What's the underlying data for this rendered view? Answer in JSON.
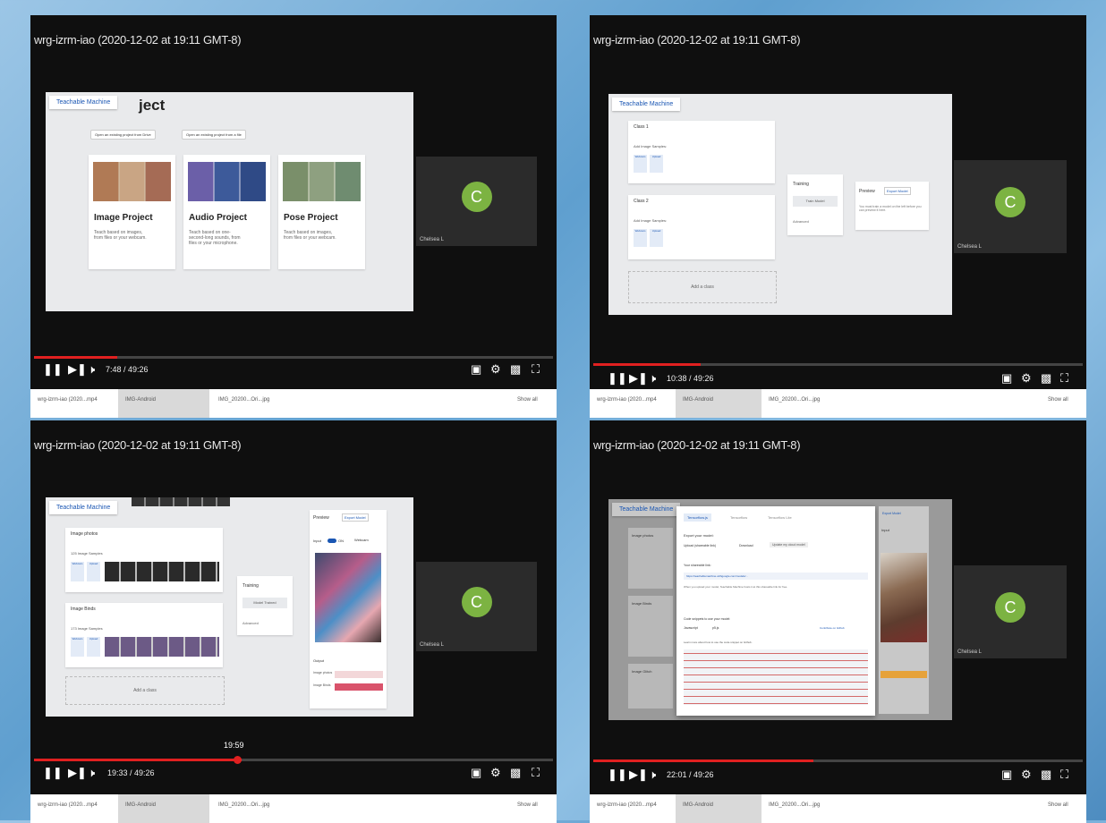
{
  "quadrants": [
    {
      "title": "wrg-izrm-iao (2020-12-02 at 19:11 GMT-8)",
      "time": "7:48 / 49:26",
      "progress_fraction": 0.16,
      "slide": {
        "header": "Teachable Machine",
        "heading": "ject",
        "btn_open_drive": "Open an existing project from Drive",
        "btn_open_file": "Open an existing project from a file",
        "cards": [
          {
            "title": "Image Project",
            "desc": "Teach based on images, from files or your webcam."
          },
          {
            "title": "Audio Project",
            "desc": "Teach based on one-second-long sounds, from files or your microphone."
          },
          {
            "title": "Pose Project",
            "desc": "Teach based on images, from files or your webcam."
          }
        ]
      },
      "participant": {
        "initial": "C",
        "name": "Chelsea L"
      },
      "taskbar": [
        "wrg-izrm-iao (2020...mp4",
        "IMG-Android",
        "IMG_20200...Ori...jpg",
        "Show all"
      ]
    },
    {
      "title": "wrg-izrm-iao (2020-12-02 at 19:11 GMT-8)",
      "time": "10:38 / 49:26",
      "progress_fraction": 0.22,
      "slide": {
        "header": "Teachable Machine",
        "class1": "Class 1",
        "class2": "Class 2",
        "add_samples": "Add Image Samples:",
        "webcam": "Webcam",
        "upload": "Upload",
        "training": "Training",
        "train_model": "Train Model",
        "advanced": "Advanced",
        "preview": "Preview",
        "export_model": "Export Model",
        "preview_note": "You must train a model on the left before you can preview it here.",
        "add_class": "Add a class"
      },
      "participant": {
        "initial": "C",
        "name": "Chelsea L"
      },
      "taskbar": [
        "wrg-izrm-iao (2020...mp4",
        "IMG-Android",
        "IMG_20200...Ori...jpg",
        "Show all"
      ]
    },
    {
      "title": "wrg-izrm-iao (2020-12-02 at 19:11 GMT-8)",
      "time": "19:33 / 49:26",
      "progress_fraction": 0.4,
      "tooltip": "19:59",
      "slide": {
        "header": "Teachable Machine",
        "class1": "Image photos",
        "class2": "Image Binds",
        "samples1": "125 Image Samples",
        "samples2": "173 Image Samples",
        "webcam": "Webcam",
        "upload": "Upload",
        "training": "Training",
        "train_model": "Model Trained",
        "advanced": "Advanced",
        "preview": "Preview",
        "export_model": "Export Model",
        "input": "Input",
        "on": "ON",
        "webcam_select": "Webcam",
        "output": "Output",
        "out1": "Image photos",
        "out2": "Image Binds",
        "add_class": "Add a class"
      },
      "participant": {
        "initial": "C",
        "name": "Chelsea L"
      },
      "taskbar": [
        "wrg-izrm-iao (2020...mp4",
        "IMG-Android",
        "IMG_20200...Ori...jpg",
        "Show all"
      ]
    },
    {
      "title": "wrg-izrm-iao (2020-12-02 at 19:11 GMT-8)",
      "time": "22:01 / 49:26",
      "progress_fraction": 0.45,
      "slide": {
        "header": "Teachable Machine",
        "tab1": "Tensorflow.js",
        "tab2": "Tensorflow",
        "tab3": "Tensorflow Lite",
        "export_model": "Export Model",
        "export_title": "Export your model:",
        "opt1": "Upload (shareable link)",
        "opt2": "Download",
        "btn_upload": "Update my cloud model",
        "shareable": "Your shareable link:",
        "link": "https://teachablemachine.withgoogle.com/models/...",
        "note": "When you upload your model, Teachable Machine hosts it at this shareable link for free.",
        "code_label": "Code snippets to use your model:",
        "js": "Javascript",
        "p5": "p5.js",
        "contribute": "Contribute on Github",
        "learn_more": "Learn more about how to use the code snippet on Github.",
        "class1": "Image photos",
        "class2": "Image Binds",
        "class3": "Image Glitch",
        "input": "Input"
      },
      "participant": {
        "initial": "C",
        "name": "Chelsea L"
      },
      "taskbar": [
        "wrg-izrm-iao (2020...mp4",
        "IMG-Android",
        "IMG_20200...Ori...jpg",
        "Show all"
      ]
    }
  ]
}
